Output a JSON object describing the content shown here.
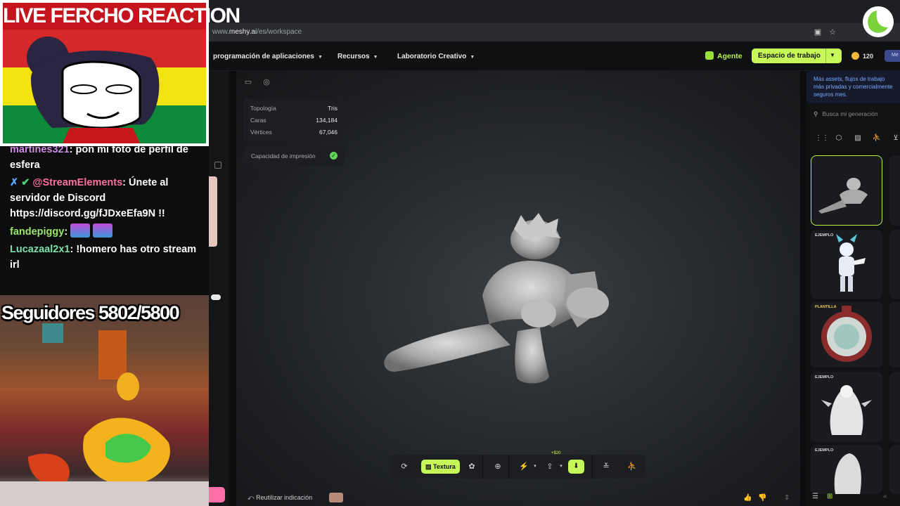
{
  "browser": {
    "url_prefix": "www.",
    "url_domain": "meshy.ai",
    "url_path": "/es/workspace"
  },
  "nav": {
    "items": [
      {
        "label": "programación de aplicaciones"
      },
      {
        "label": "Recursos"
      },
      {
        "label": "Laboratorio Creativo"
      }
    ],
    "agent_label": "Agente",
    "workspace_label": "Espacio de trabajo",
    "credits": "120",
    "plan_badge": "Me"
  },
  "stats": {
    "rows": [
      {
        "label": "Topología",
        "value": "Tris"
      },
      {
        "label": "Caras",
        "value": "134,184"
      },
      {
        "label": "Vértices",
        "value": "67,046"
      }
    ],
    "print_label": "Capacidad de impresión"
  },
  "toolbar": {
    "texture_label": "Textura",
    "cost_badge": "+$20"
  },
  "footer": {
    "reuse_label": "Reutilizar indicación"
  },
  "sidebar": {
    "promo": "Más assets, flujos de trabajo más privadas y comercialmente seguros mes.",
    "search_placeholder": "Busca mi generación",
    "cards": [
      {
        "tag": ""
      },
      {
        "tag": "EJEMPLO"
      },
      {
        "tag": "PLANTILLA"
      },
      {
        "tag": "EJEMPLO"
      },
      {
        "tag": "EJEMPLO"
      }
    ]
  },
  "overlay": {
    "title": "LIVE FERCHO REACTION",
    "chat": [
      {
        "user": "martines321",
        "text": "pon mi foto de perfil de esfera"
      },
      {
        "user": "@StreamElements",
        "text": "Únete al servidor de Discord https://discord.gg/fJDxeEfa9N !!"
      },
      {
        "user": "fandepiggy",
        "text": ""
      },
      {
        "user": "Lucazaal2x1",
        "text": "!homero has otro stream irl"
      }
    ],
    "followers": "Seguidores 5802/5800"
  },
  "colors": {
    "accent": "#c6f85a",
    "agent_green": "#b8f24a",
    "title_red": "#c4141d"
  }
}
